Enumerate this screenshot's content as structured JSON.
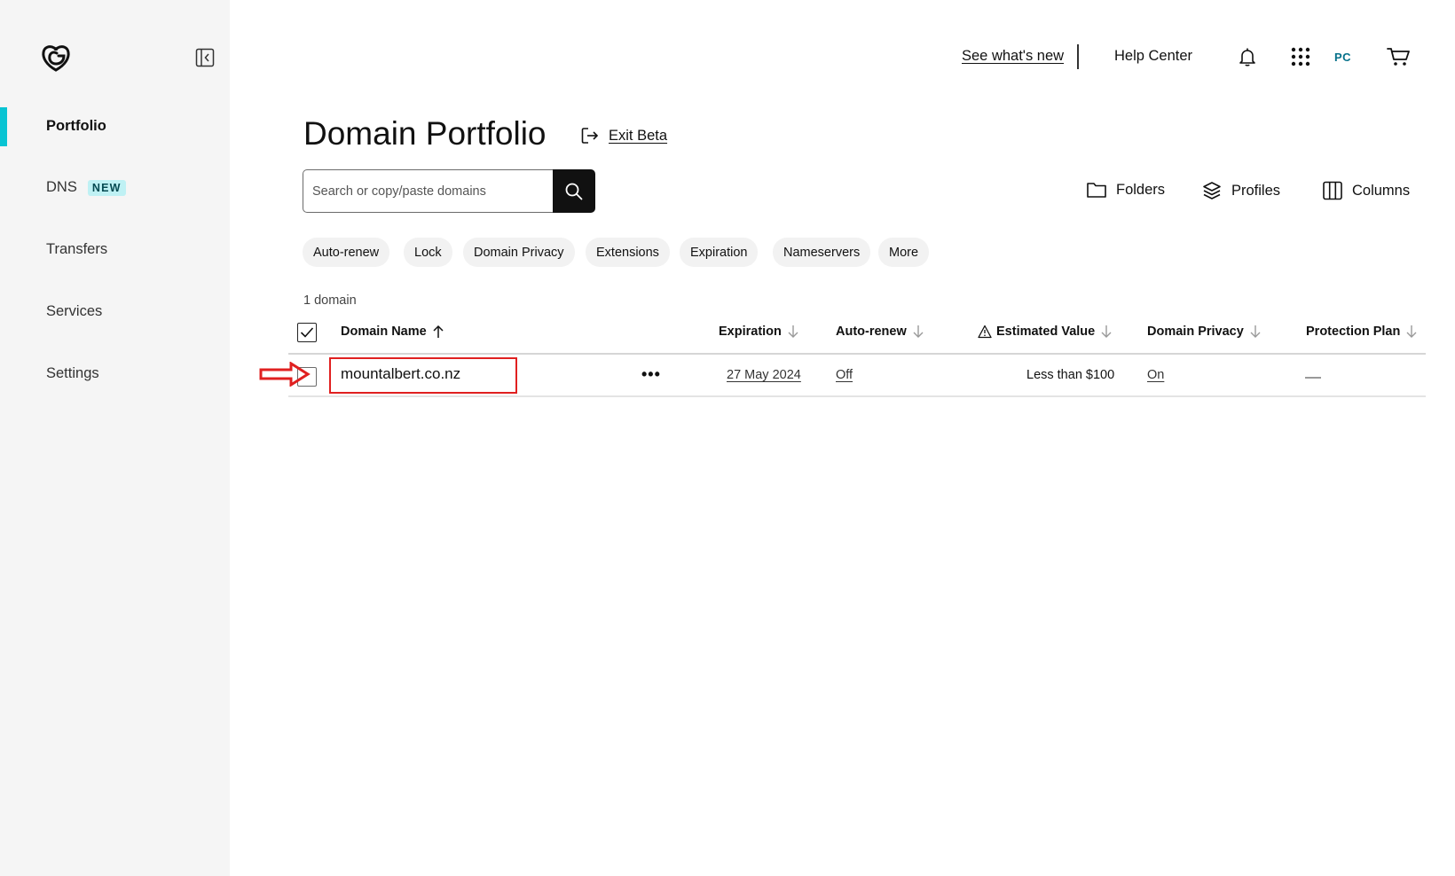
{
  "sidebar": {
    "logo_icon": "godaddy-logo-icon",
    "collapse_icon": "sidebar-collapse-icon",
    "items": [
      {
        "label": "Portfolio",
        "active": true
      },
      {
        "label": "DNS",
        "badge": "NEW"
      },
      {
        "label": "Transfers"
      },
      {
        "label": "Services"
      },
      {
        "label": "Settings"
      }
    ],
    "accent_color": "#09c4d3"
  },
  "topbar": {
    "whats_new": "See what's new",
    "help_center": "Help Center",
    "bell_icon": "bell-icon",
    "apps_icon": "apps-grid-icon",
    "avatar_initials": "PC",
    "cart_icon": "cart-icon"
  },
  "page": {
    "title": "Domain Portfolio",
    "exit_beta": "Exit Beta"
  },
  "search": {
    "placeholder": "Search or copy/paste domains",
    "value": ""
  },
  "toolbar": {
    "folders": "Folders",
    "profiles": "Profiles",
    "columns": "Columns"
  },
  "filters": [
    "Auto-renew",
    "Lock",
    "Domain Privacy",
    "Extensions",
    "Expiration",
    "Nameservers",
    "More"
  ],
  "table": {
    "count": "1 domain",
    "columns": {
      "domain_name": "Domain Name",
      "expiration": "Expiration",
      "auto_renew": "Auto-renew",
      "estimated_value": "Estimated Value",
      "domain_privacy": "Domain Privacy",
      "protection_plan": "Protection Plan"
    },
    "rows": [
      {
        "domain": "mountalbert.co.nz",
        "menu": "•••",
        "expiration": "27 May 2024",
        "auto_renew": "Off",
        "estimated_value": "Less than $100",
        "domain_privacy": "On",
        "protection_plan": ""
      }
    ]
  },
  "annotation": {
    "color": "#e02020"
  }
}
